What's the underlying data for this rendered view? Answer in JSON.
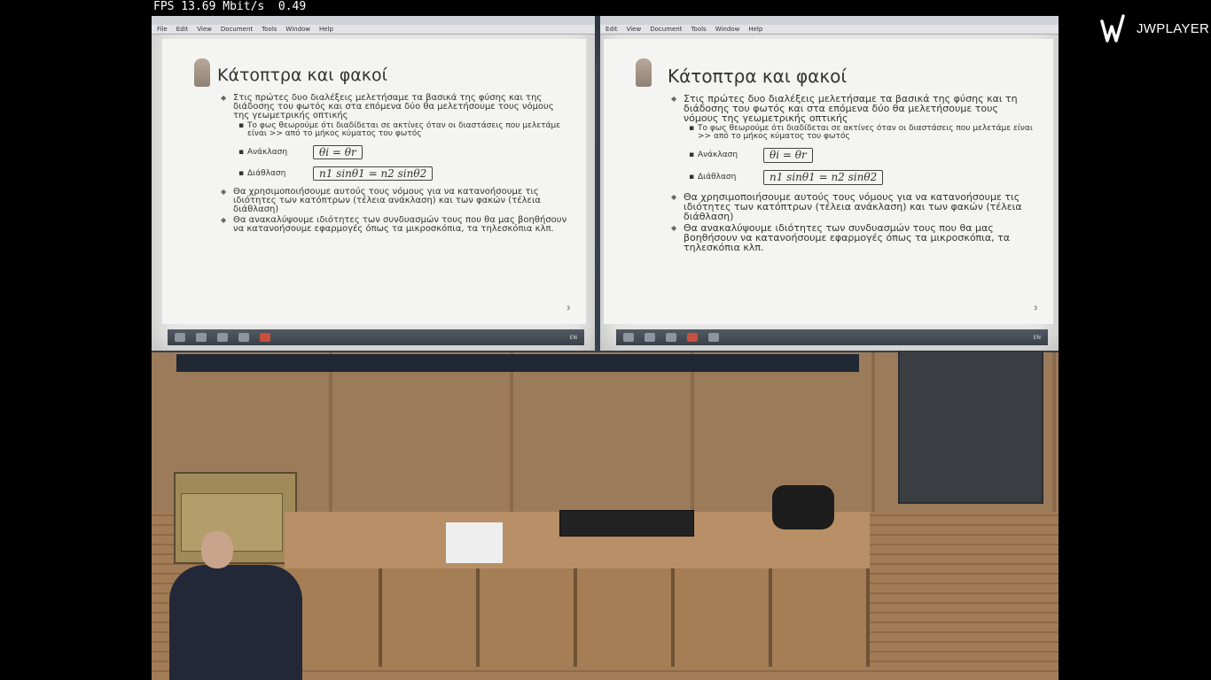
{
  "stats": {
    "text": "FPS 13.69 Mbit/s  0.49"
  },
  "player": {
    "brand": "JWPLAYER",
    "logo_icon": "jw-logo-icon"
  },
  "screens": [
    {
      "menu": [
        "File",
        "Edit",
        "View",
        "Document",
        "Tools",
        "Window",
        "Help"
      ],
      "slide": {
        "title": "Κάτοπτρα και φακοί",
        "b1": "Στις πρώτες δυο διαλέξεις μελετήσαμε τα βασικά της φύσης και της διάδοσης του φωτός και στα επόμενα δύο θα μελετήσουμε τους νόμους της γεωμετρικής οπτικής",
        "s1": "Το φως θεωρούμε ότι διαδίδεται σε ακτίνες όταν οι διαστάσεις που μελετάμε είναι >> από το μήκος κύματος του φωτός",
        "law1_name": "Ανάκλαση",
        "law1_formula": "θi = θr",
        "law2_name": "Διάθλαση",
        "law2_formula": "n1 sinθ1 = n2 sinθ2",
        "b2": "Θα χρησιμοποιήσουμε αυτούς τους νόμους για να κατανοήσουμε τις ιδιότητες των κατόπτρων (τέλεια ανάκλαση) και των φακών (τέλεια διάθλαση)",
        "b3": "Θα ανακαλύψουμε ιδιότητες των συνδυασμών τους που θα μας βοηθήσουν να κατανοήσουμε εφαρμογές όπως τα μικροσκόπια, τα τηλεσκόπια κλπ.",
        "slide_number": "3"
      },
      "tray": "EN"
    },
    {
      "menu": [
        "Edit",
        "View",
        "Document",
        "Tools",
        "Window",
        "Help"
      ],
      "slide": {
        "title": "Κάτοπτρα και φακοί",
        "b1": "Στις πρώτες δυο διαλέξεις μελετήσαμε τα βασικά της φύσης και τη διάδοσης του φωτός και στα επόμενα δύο θα μελετήσουμε τους νόμους της γεωμετρικής οπτικής",
        "s1": "Το φως θεωρούμε ότι διαδίδεται σε ακτίνες όταν οι διαστάσεις που μελετάμε είναι >> από το μήκος κύματος του φωτός",
        "law1_name": "Ανάκλαση",
        "law1_formula": "θi = θr",
        "law2_name": "Διάθλαση",
        "law2_formula": "n1 sinθ1 = n2 sinθ2",
        "b2": "Θα χρησιμοποιήσουμε αυτούς τους νόμους για να κατανοήσουμε τις ιδιότητες των κατόπτρων (τέλεια ανάκλαση) και των φακών (τέλεια διάθλαση)",
        "b3": "Θα ανακαλύψουμε ιδιότητες των συνδυασμών τους που θα μας βοηθήσουν να κατανοήσουμε εφαρμογές όπως τα μικροσκόπια, τα τηλεσκόπια κλπ.",
        "slide_number": "3"
      },
      "tray": "EN"
    }
  ]
}
